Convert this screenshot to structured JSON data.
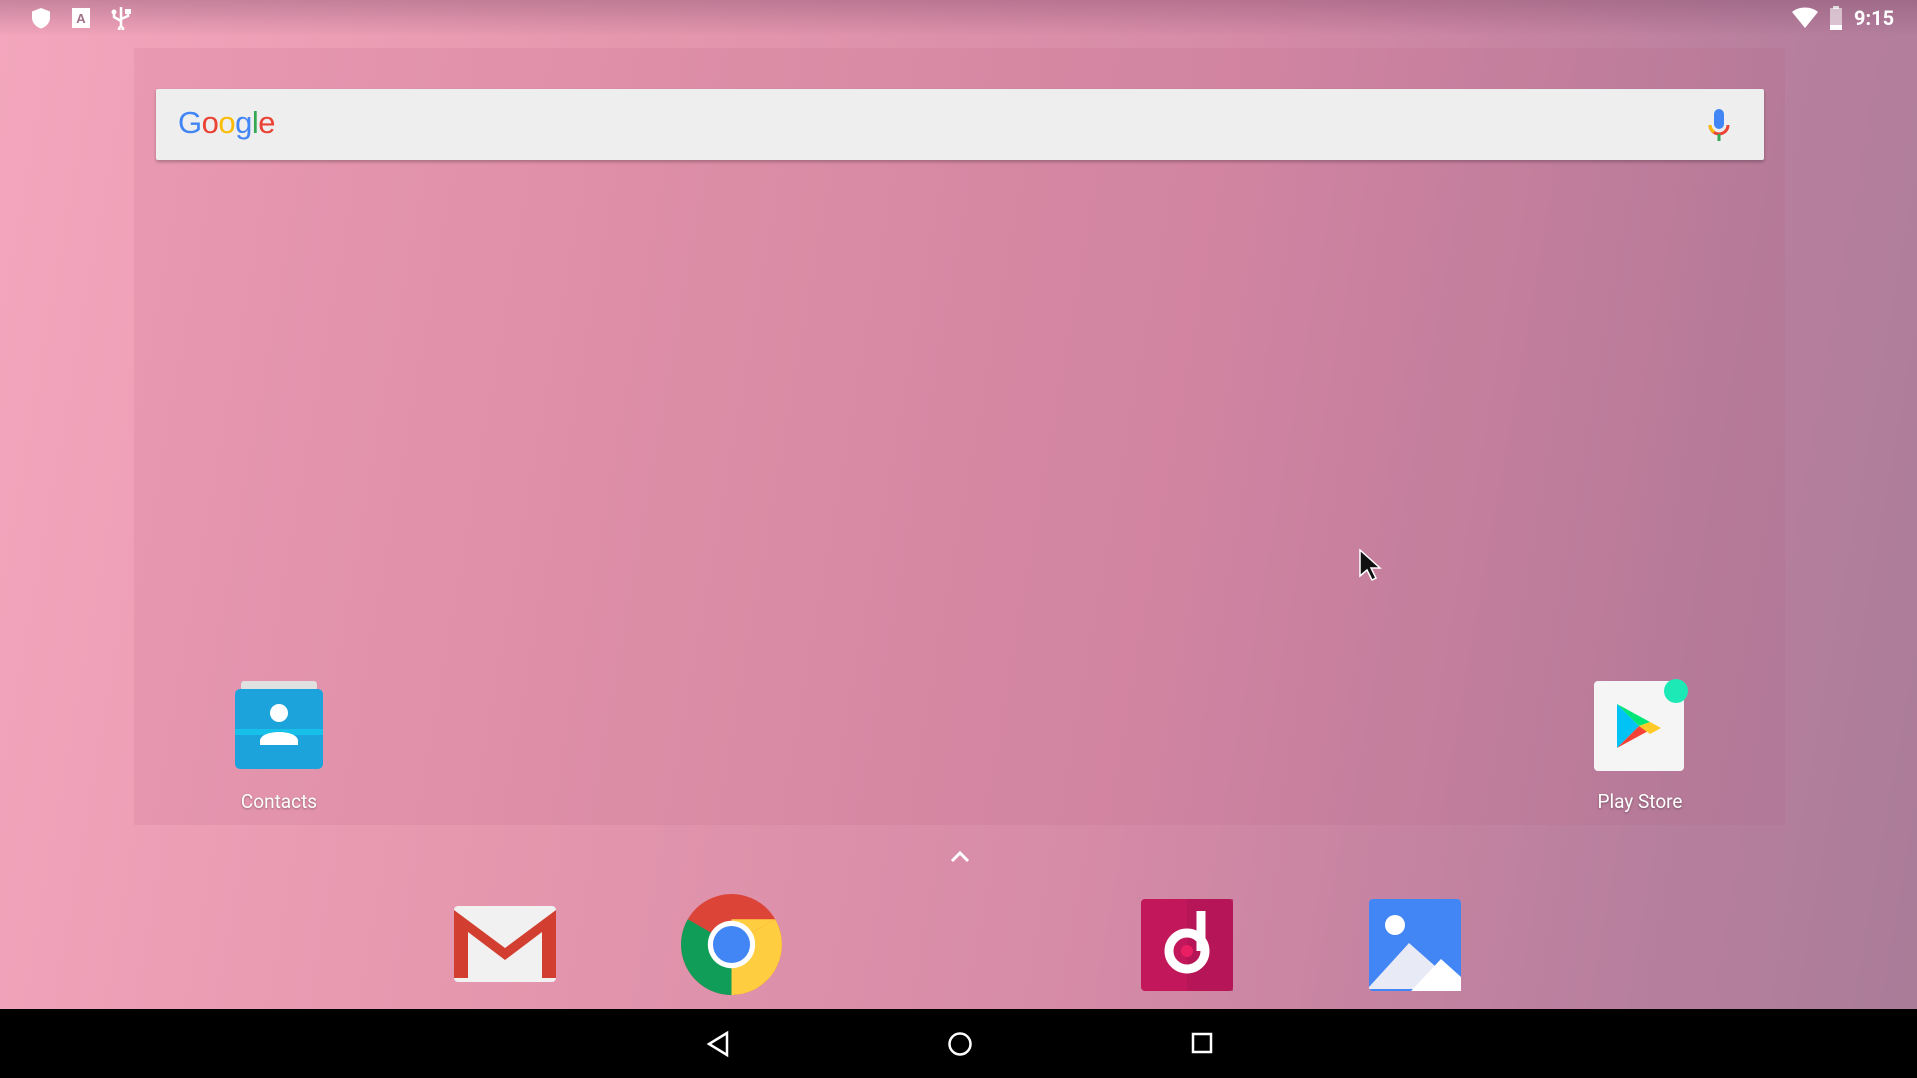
{
  "status_bar": {
    "left_icons": [
      "shield-icon",
      "keyboard-a-icon",
      "usb-icon"
    ],
    "right_icons": [
      "wifi-icon",
      "battery-icon"
    ],
    "time": "9:15"
  },
  "search_bar": {
    "logo": "Google",
    "mic_icon": "mic-icon"
  },
  "desktop_apps": [
    {
      "label": "Contacts",
      "icon": "contacts-icon"
    },
    {
      "label": "Play Store",
      "icon": "play-store-icon",
      "notification_dot_color": "#1de9b6"
    }
  ],
  "dock": {
    "apps": [
      "gmail-icon",
      "chrome-icon",
      "music-icon",
      "gallery-icon"
    ],
    "app_drawer_icon": "chevron-up-icon"
  },
  "nav_bar": {
    "buttons": [
      "back",
      "home",
      "recents"
    ]
  },
  "colors": {
    "wallpaper": "#e597ae",
    "nav_bar": "#000000"
  }
}
